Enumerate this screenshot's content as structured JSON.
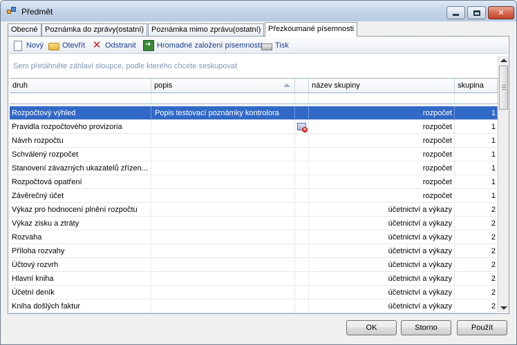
{
  "window": {
    "title": "Předmět"
  },
  "tabs": [
    {
      "label": "Obecné"
    },
    {
      "label": "Poznámka do zprávy(ostatní)"
    },
    {
      "label": "Poznámka mimo zprávu(ostatní)"
    },
    {
      "label": "Přezkoumané písemnosti",
      "active": true
    }
  ],
  "toolbar": {
    "new_label": "Nový",
    "open_label": "Otevřít",
    "delete_label": "Odstranit",
    "bulk_label": "Hromadné založení písemností",
    "print_label": "Tisk"
  },
  "group_hint": "Sem přetáhněte záhlaví sloupce, podle kterého chcete seskupovat",
  "grid": {
    "columns": [
      "druh",
      "popis",
      "",
      "název skupiny",
      "skupina"
    ],
    "sorted_column": "popis",
    "rows": [
      {
        "druh": "Rozpočtový výhled",
        "popis": "Popis testovací poznámky kontrolora",
        "nazev": "rozpočet",
        "skupina": "1",
        "selected": true
      },
      {
        "druh": "Pravidla rozpočtového provizoria",
        "popis": "",
        "nazev": "rozpočet",
        "skupina": "1",
        "icon": "delete-note-icon"
      },
      {
        "druh": "Návrh rozpočtu",
        "popis": "",
        "nazev": "rozpočet",
        "skupina": "1"
      },
      {
        "druh": "Schválený rozpočet",
        "popis": "",
        "nazev": "rozpočet",
        "skupina": "1"
      },
      {
        "druh": "Stanovení závazných ukazatelů zřízen...",
        "popis": "",
        "nazev": "rozpočet",
        "skupina": "1"
      },
      {
        "druh": "Rozpočtová opatření",
        "popis": "",
        "nazev": "rozpočet",
        "skupina": "1"
      },
      {
        "druh": "Závěrečný účet",
        "popis": "",
        "nazev": "rozpočet",
        "skupina": "1"
      },
      {
        "druh": "Výkaz pro hodnocení plnění rozpočtu",
        "popis": "",
        "nazev": "účetnictví a výkazy",
        "skupina": "2"
      },
      {
        "druh": "Výkaz zisku a ztráty",
        "popis": "",
        "nazev": "účetnictví a výkazy",
        "skupina": "2"
      },
      {
        "druh": "Rozvaha",
        "popis": "",
        "nazev": "účetnictví a výkazy",
        "skupina": "2"
      },
      {
        "druh": "Příloha rozvahy",
        "popis": "",
        "nazev": "účetnictví a výkazy",
        "skupina": "2"
      },
      {
        "druh": "Účtový rozvrh",
        "popis": "",
        "nazev": "účetnictví a výkazy",
        "skupina": "2"
      },
      {
        "druh": "Hlavní kniha",
        "popis": "",
        "nazev": "účetnictví a výkazy",
        "skupina": "2"
      },
      {
        "druh": "Účetní deník",
        "popis": "",
        "nazev": "účetnictví a výkazy",
        "skupina": "2"
      },
      {
        "druh": "Kniha došlých faktur",
        "popis": "",
        "nazev": "účetnictví a výkazy",
        "skupina": "2"
      }
    ]
  },
  "buttons": {
    "ok": "OK",
    "storno": "Storno",
    "pouzit": "Použít"
  }
}
